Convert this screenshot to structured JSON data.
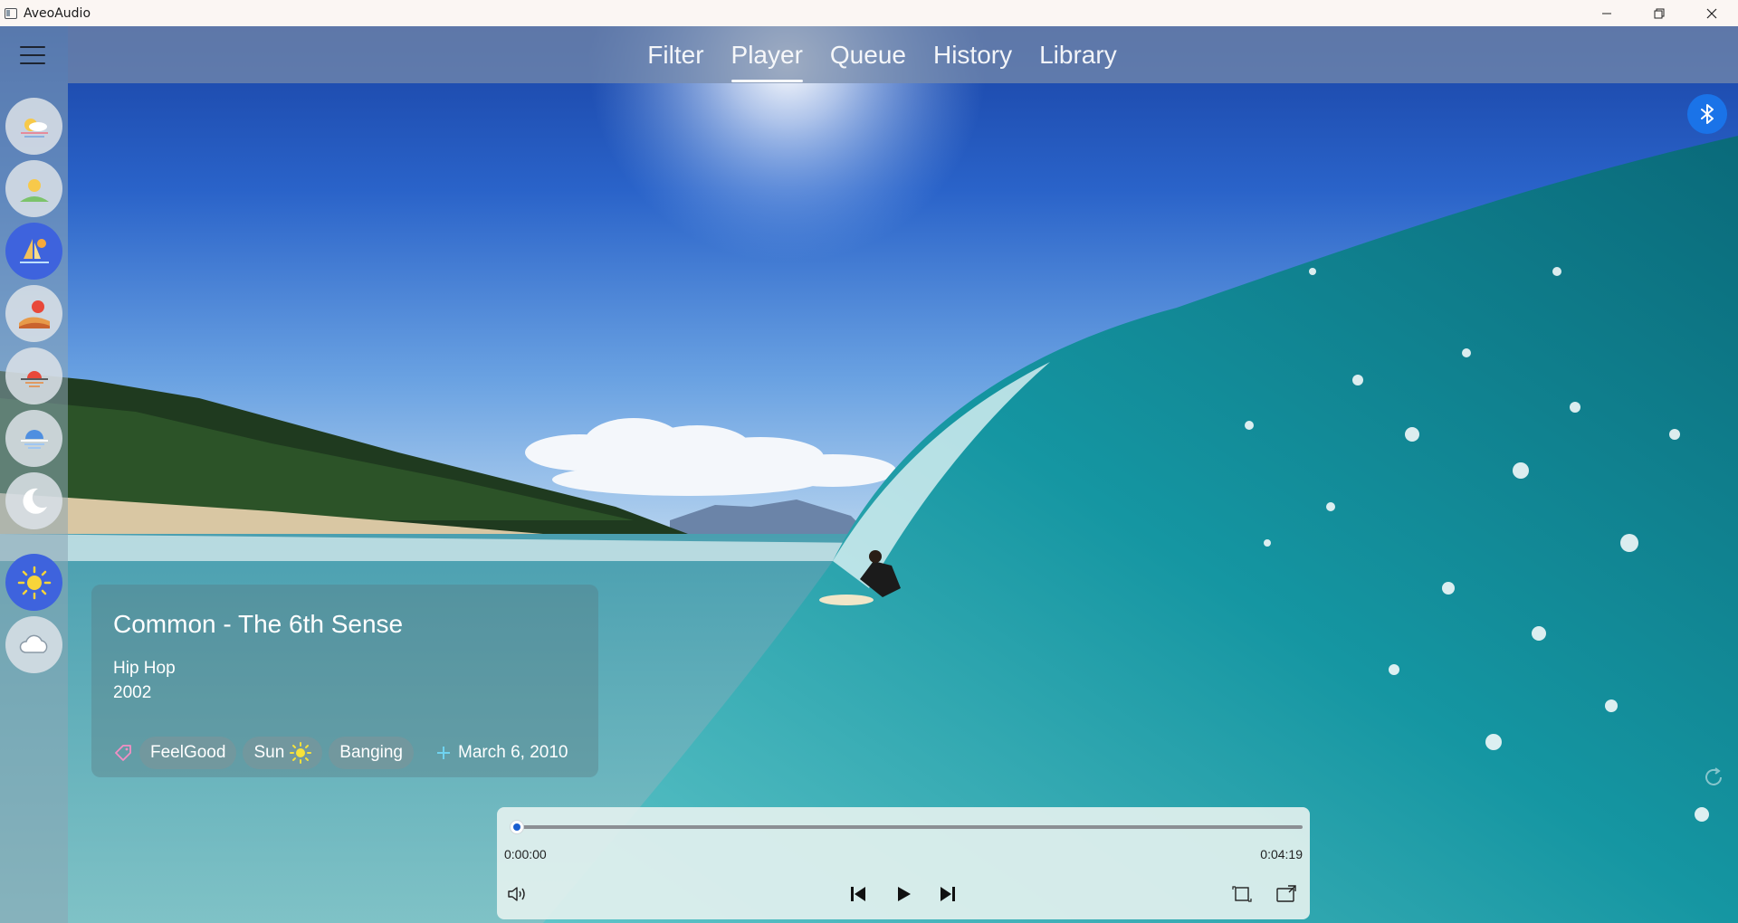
{
  "window": {
    "title": "AveoAudio"
  },
  "nav": {
    "tabs": [
      {
        "label": "Filter"
      },
      {
        "label": "Player"
      },
      {
        "label": "Queue"
      },
      {
        "label": "History"
      },
      {
        "label": "Library"
      }
    ],
    "active_tab": "Player"
  },
  "rail": {
    "items": [
      {
        "icon": "sunrise-icon"
      },
      {
        "icon": "morning-icon"
      },
      {
        "icon": "sailing-day-icon",
        "selected": true
      },
      {
        "icon": "desert-afternoon-icon"
      },
      {
        "icon": "sunset-icon"
      },
      {
        "icon": "evening-icon"
      },
      {
        "icon": "night-moon-icon"
      },
      {
        "icon": "sun-weather-icon",
        "selected": true
      },
      {
        "icon": "cloud-weather-icon"
      }
    ]
  },
  "track": {
    "title": "Common - The 6th Sense",
    "genre": "Hip Hop",
    "year": "2002",
    "tags": [
      "FeelGood",
      "Sun",
      "Banging"
    ],
    "added_date": "March 6, 2010"
  },
  "player": {
    "elapsed": "0:00:00",
    "duration": "0:04:19",
    "progress": 0.0
  },
  "colors": {
    "accent": "#3e63dd",
    "bluetooth": "#1a73e8",
    "seek_knob": "#1a5fd0"
  }
}
